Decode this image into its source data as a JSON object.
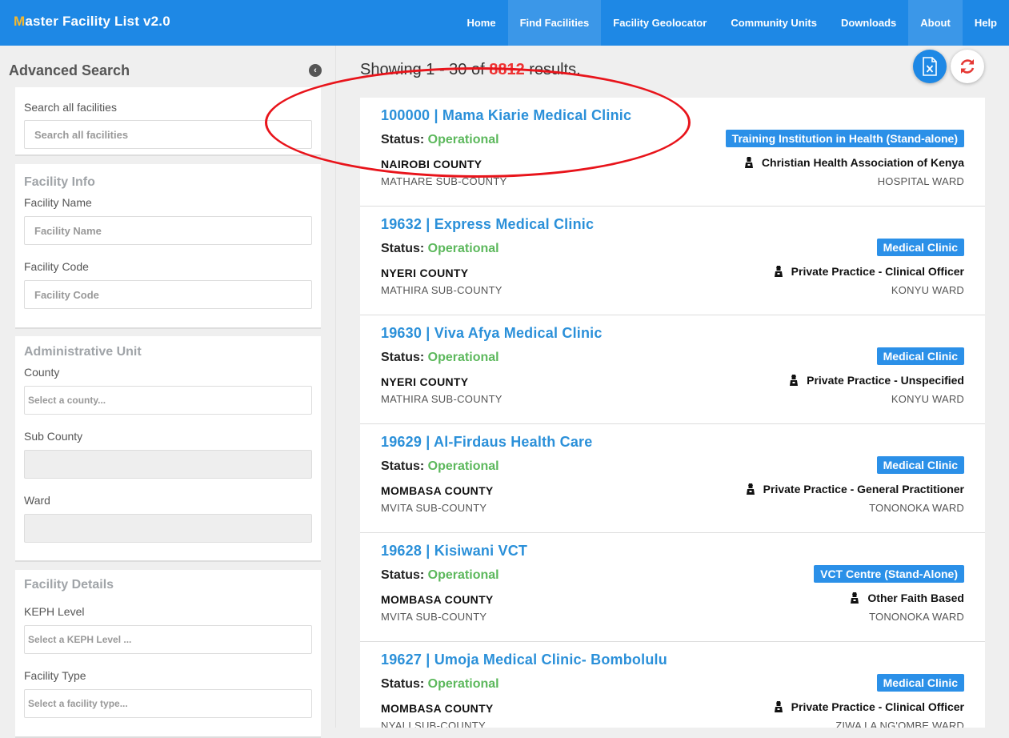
{
  "brand": {
    "first_letter": "M",
    "rest": "aster Facility List v2.0"
  },
  "nav": [
    {
      "label": "Home",
      "active": false
    },
    {
      "label": "Find Facilities",
      "active": true
    },
    {
      "label": "Facility Geolocator",
      "active": false
    },
    {
      "label": "Community Units",
      "active": false
    },
    {
      "label": "Downloads",
      "active": false
    },
    {
      "label": "About",
      "active": true
    },
    {
      "label": "Help",
      "active": false
    }
  ],
  "sidebar": {
    "title": "Advanced Search",
    "collapse_icon": "chevron-left-circle-icon",
    "search": {
      "label": "Search all facilities",
      "placeholder": "Search all facilities"
    },
    "facility_info": {
      "title": "Facility Info",
      "name_label": "Facility Name",
      "name_placeholder": "Facility Name",
      "code_label": "Facility Code",
      "code_placeholder": "Facility Code"
    },
    "admin_unit": {
      "title": "Administrative Unit",
      "county_label": "County",
      "county_placeholder": "Select a county...",
      "sub_county_label": "Sub County",
      "ward_label": "Ward"
    },
    "facility_details": {
      "title": "Facility Details",
      "keph_label": "KEPH Level",
      "keph_placeholder": "Select a KEPH Level ...",
      "type_label": "Facility Type",
      "type_placeholder": "Select a facility type..."
    }
  },
  "results": {
    "prefix": "Showing 1 - 30 of ",
    "count": "8812",
    "suffix": " results.",
    "excel_icon": "excel-export-icon",
    "refresh_icon": "refresh-icon",
    "status_label": "Status: ",
    "items": [
      {
        "title": "100000 | Mama Kiarie Medical Clinic",
        "status": "Operational",
        "county": "NAIROBI COUNTY",
        "sub_county": "MATHARE SUB-COUNTY",
        "type": "Training Institution in Health (Stand-alone)",
        "owner": "Christian Health Association of Kenya",
        "ward": "HOSPITAL WARD"
      },
      {
        "title": "19632 | Express Medical Clinic",
        "status": "Operational",
        "county": "NYERI COUNTY",
        "sub_county": "MATHIRA SUB-COUNTY",
        "type": "Medical Clinic",
        "owner": "Private Practice - Clinical Officer",
        "ward": "KONYU WARD"
      },
      {
        "title": "19630 | Viva Afya Medical Clinic",
        "status": "Operational",
        "county": "NYERI COUNTY",
        "sub_county": "MATHIRA SUB-COUNTY",
        "type": "Medical Clinic",
        "owner": "Private Practice - Unspecified",
        "ward": "KONYU WARD"
      },
      {
        "title": "19629 | Al-Firdaus Health Care",
        "status": "Operational",
        "county": "MOMBASA COUNTY",
        "sub_county": "MVITA SUB-COUNTY",
        "type": "Medical Clinic",
        "owner": "Private Practice - General Practitioner",
        "ward": "TONONOKA WARD"
      },
      {
        "title": "19628 | Kisiwani VCT",
        "status": "Operational",
        "county": "MOMBASA COUNTY",
        "sub_county": "MVITA SUB-COUNTY",
        "type": "VCT Centre (Stand-Alone)",
        "owner": "Other Faith Based",
        "ward": "TONONOKA WARD"
      },
      {
        "title": "19627 | Umoja Medical Clinic- Bombolulu",
        "status": "Operational",
        "county": "MOMBASA COUNTY",
        "sub_county": "NYALI SUB-COUNTY",
        "type": "Medical Clinic",
        "owner": "Private Practice - Clinical Officer",
        "ward": "ZIWA LA NG'OMBE WARD"
      }
    ]
  },
  "colors": {
    "navbar": "#1e88e5",
    "brand_accent": "#f5b82e",
    "link": "#2b90d9",
    "operational": "#5cb85c",
    "count": "#e33333",
    "annotation": "#e8141b"
  }
}
